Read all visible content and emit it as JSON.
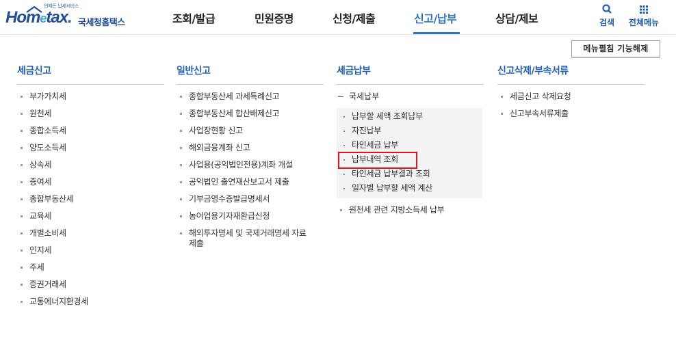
{
  "logo": {
    "tagline": "언제든 납세서비스",
    "wordmark_a": "Hom",
    "wordmark_e": "e",
    "wordmark_b": "tax.",
    "service_name": "국세청홈택스"
  },
  "gnb": {
    "items": [
      {
        "label": "조회/발급"
      },
      {
        "label": "민원증명"
      },
      {
        "label": "신청/제출"
      },
      {
        "label": "신고/납부"
      },
      {
        "label": "상담/제보"
      }
    ],
    "active_index": 3,
    "accent_color": "#2e74c9"
  },
  "util": {
    "search_label": "검색",
    "search_icon": "search-icon",
    "allmenu_label": "전체메뉴",
    "allmenu_icon": "grid-icon"
  },
  "fold_button_label": "메뉴펼침 기능해제",
  "columns": {
    "tax_report": {
      "title": "세금신고",
      "items": [
        "부가가치세",
        "원천세",
        "종합소득세",
        "양도소득세",
        "상속세",
        "증여세",
        "종합부동산세",
        "교육세",
        "개별소비세",
        "인지세",
        "주세",
        "증권거래세",
        "교통에너지환경세"
      ]
    },
    "general_report": {
      "title": "일반신고",
      "items": [
        "종합부동산세 과세특례신고",
        "종합부동산세 합산배제신고",
        "사업장현황 신고",
        "해외금융계좌 신고",
        "사업용(공익법인전용)계좌 개설",
        "공익법인 출연재산보고서 제출",
        "기부금영수증발급명세서",
        "농어업용기자재환급신청",
        "해외투자명세 및 국제거래명세 자료\n제출"
      ]
    },
    "tax_payment": {
      "title": "세금납부",
      "group_label": "국세납부",
      "sub_items": [
        "납부할 세액 조회납부",
        "자진납부",
        "타인세금 납부",
        "납부내역 조회",
        "타인세금 납부결과 조회",
        "일자별 납부할 세액 계산"
      ],
      "highlighted_index": 3,
      "after_items": [
        "원천세 관련 지방소득세 납부"
      ]
    },
    "report_delete": {
      "title": "신고삭제/부속서류",
      "items": [
        "세금신고 삭제요청",
        "신고부속서류제출"
      ]
    }
  },
  "colors": {
    "title_blue": "#1f5fb8",
    "highlight_red": "#e0141e"
  }
}
